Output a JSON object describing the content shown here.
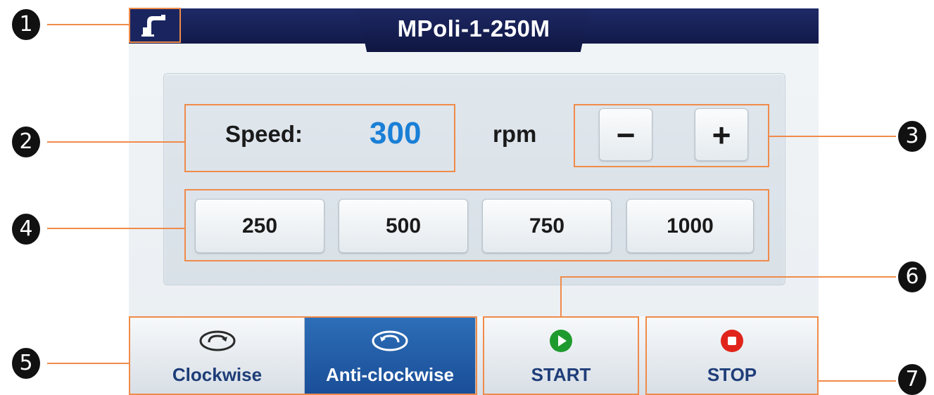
{
  "header": {
    "title": "MPoli-1-250M",
    "home_icon": "faucet-icon"
  },
  "speed": {
    "label": "Speed:",
    "value": "300",
    "unit": "rpm",
    "decrease_label": "−",
    "increase_label": "+"
  },
  "presets": [
    "250",
    "500",
    "750",
    "1000"
  ],
  "direction": {
    "clockwise_label": "Clockwise",
    "anticlockwise_label": "Anti-clockwise",
    "selected": "Anti-clockwise"
  },
  "controls": {
    "start_label": "START",
    "stop_label": "STOP"
  },
  "callouts": [
    "1",
    "2",
    "3",
    "4",
    "5",
    "6",
    "7"
  ],
  "colors": {
    "title_bar": "#141c4f",
    "speed_value": "#1a7fd6",
    "active_direction": "#1f5aa3",
    "start_icon": "#1f9a2e",
    "stop_icon": "#e0241b",
    "callout_line": "#f08b4a"
  }
}
